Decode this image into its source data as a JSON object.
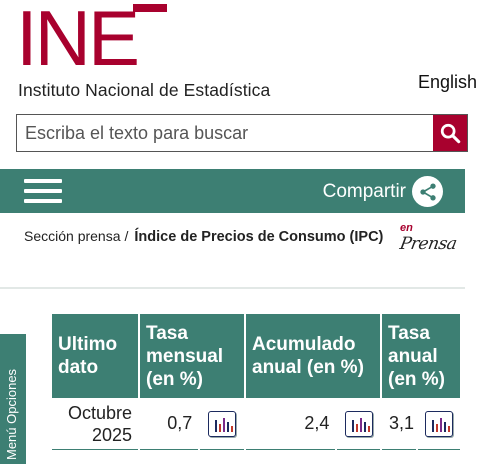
{
  "header": {
    "logo_text": "INE",
    "institute_name": "Instituto Nacional de Estadística",
    "language_link": "English"
  },
  "search": {
    "placeholder": "Escriba el texto para buscar",
    "value": ""
  },
  "navbar": {
    "share_label": "Compartir"
  },
  "breadcrumb": {
    "section": "Sección prensa",
    "separator": "/",
    "current": "Índice de Precios de Consumo (IPC)"
  },
  "prensa_badge": {
    "en": "en",
    "prensa": "Prensa"
  },
  "side_menu": {
    "label": "Menú Opciones"
  },
  "table": {
    "headers": {
      "period": "Ultimo dato",
      "monthly": "Tasa mensual (en %)",
      "cumulative": "Acumulado anual (en %)",
      "annual": "Tasa anual (en %)"
    },
    "rows": [
      {
        "period": "Octubre 2025",
        "monthly": "0,7",
        "cumulative": "2,4",
        "annual": "3,1"
      }
    ]
  },
  "icons": {
    "search": "search-icon",
    "share": "share-icon",
    "menu": "hamburger-icon",
    "chart": "bar-chart-icon"
  },
  "colors": {
    "brand_red": "#a8012e",
    "teal": "#3d7f73",
    "chart_bars": [
      "#1c2a5e",
      "#c0392b",
      "#7b2b8a"
    ]
  }
}
